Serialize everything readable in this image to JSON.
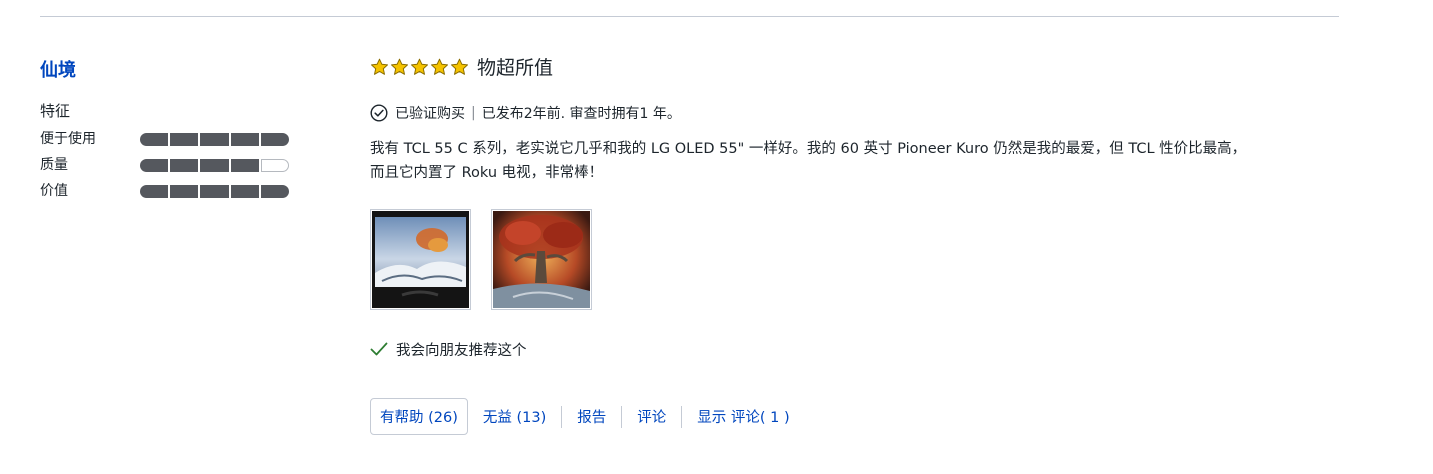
{
  "reviewer": {
    "name": "仙境"
  },
  "features": {
    "heading": "特征",
    "items": [
      {
        "label": "便于使用",
        "rating": 5,
        "max": 5
      },
      {
        "label": "质量",
        "rating": 4,
        "max": 5
      },
      {
        "label": "价值",
        "rating": 5,
        "max": 5
      }
    ]
  },
  "review": {
    "rating": 5,
    "max_rating": 5,
    "title": "物超所值",
    "verified": "已验证购买",
    "posted": "已发布2年前. 审查时拥有1 年。",
    "body_line1": "我有 TCL 55 C 系列，老实说它几乎和我的 LG OLED 55\" 一样好。我的 60 英寸 Pioneer Kuro 仍然是我的最爱，但 TCL 性价比最高，",
    "body_line2": "而且它内置了 Roku 电视，非常棒！",
    "recommend": "我会向朋友推荐这个"
  },
  "actions": {
    "helpful": "有帮助 (26)",
    "unhelpful": "无益 (13)",
    "report": "报告",
    "comment": "评论",
    "show_comments": "显示 评论( 1 )"
  },
  "colors": {
    "accent": "#0046be",
    "star": "#f5c300",
    "bar_fill": "#55585e",
    "check": "#2e7d32"
  }
}
